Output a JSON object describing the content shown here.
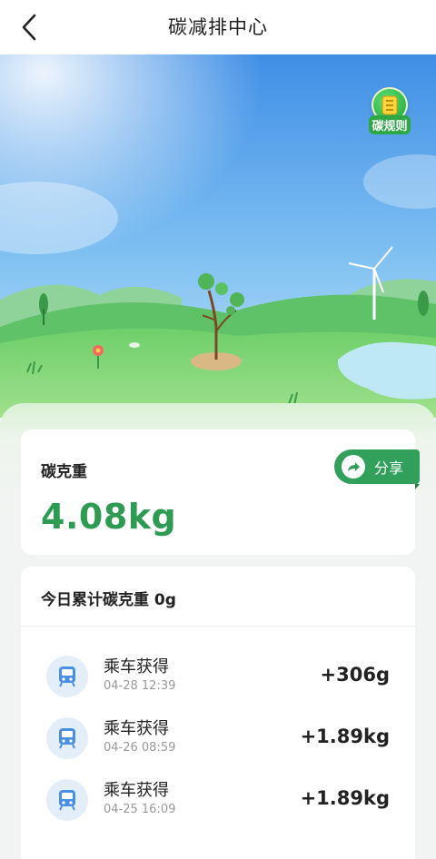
{
  "header": {
    "title": "碳减排中心",
    "back_icon": "chevron-left-icon"
  },
  "scene": {
    "rules_label": "碳规则",
    "rules_icon": "notebook-icon"
  },
  "summary": {
    "label": "碳克重",
    "value": "4.08kg",
    "share_label": "分享",
    "share_icon": "share-arrow-icon",
    "accent_color": "#2d9b52"
  },
  "records": {
    "today_total": "今日累计碳克重 0g",
    "items": [
      {
        "title": "乘车获得",
        "time": "04-28 12:39",
        "amount": "+306g",
        "icon": "bus-icon"
      },
      {
        "title": "乘车获得",
        "time": "04-26 08:59",
        "amount": "+1.89kg",
        "icon": "bus-icon"
      },
      {
        "title": "乘车获得",
        "time": "04-25 16:09",
        "amount": "+1.89kg",
        "icon": "bus-icon"
      }
    ]
  }
}
